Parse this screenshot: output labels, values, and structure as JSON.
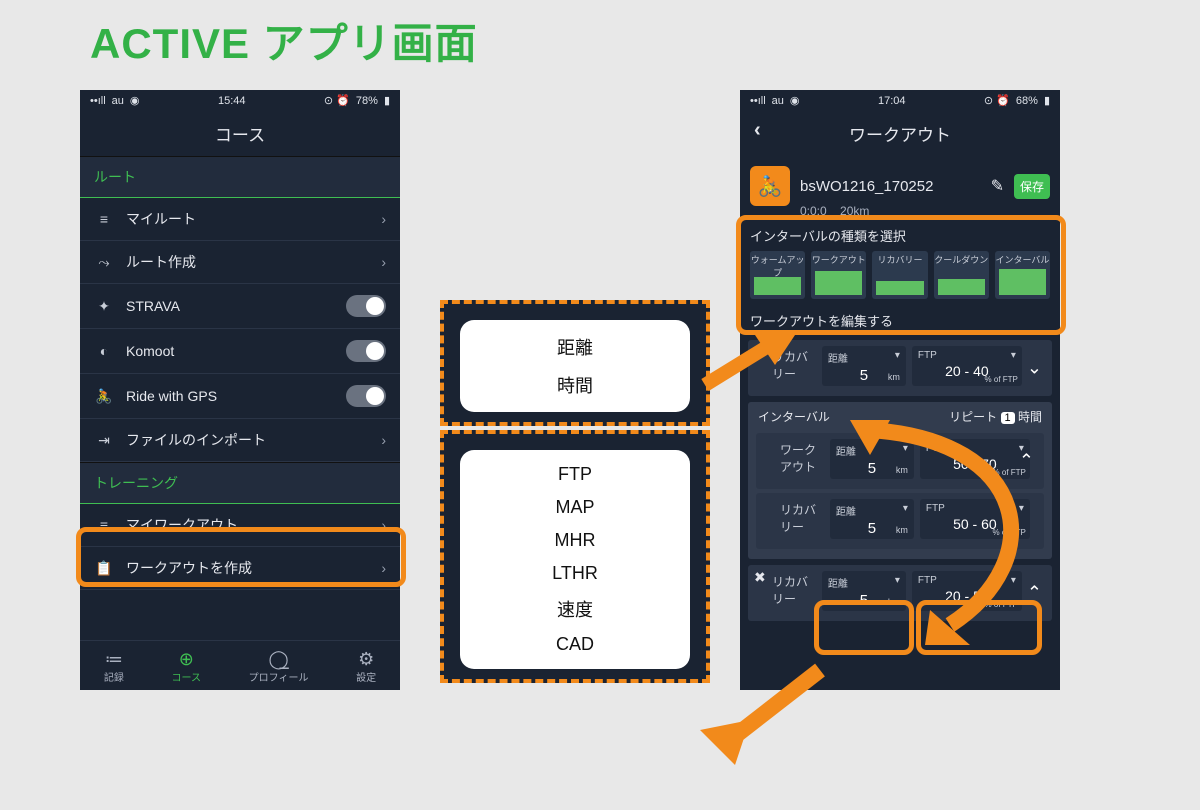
{
  "page": {
    "title": "ACTIVE アプリ画面"
  },
  "phone_left": {
    "status": {
      "carrier": "au",
      "time": "15:44",
      "battery": "78%"
    },
    "nav_title": "コース",
    "section_route": "ルート",
    "items_route": [
      {
        "label": "マイルート",
        "type": "chevron"
      },
      {
        "label": "ルート作成",
        "type": "chevron"
      },
      {
        "label": "STRAVA",
        "type": "toggle"
      },
      {
        "label": "Komoot",
        "type": "toggle"
      },
      {
        "label": "Ride with GPS",
        "type": "toggle"
      },
      {
        "label": "ファイルのインポート",
        "type": "chevron"
      }
    ],
    "section_training": "トレーニング",
    "items_training": [
      {
        "label": "マイワークアウト",
        "type": "chevron"
      },
      {
        "label": "ワークアウトを作成",
        "type": "chevron"
      }
    ],
    "tabs": [
      {
        "label": "記録"
      },
      {
        "label": "コース"
      },
      {
        "label": "プロフィール"
      },
      {
        "label": "設定"
      }
    ]
  },
  "picker_top": {
    "options": [
      "距離",
      "時間"
    ]
  },
  "picker_bottom": {
    "options": [
      "FTP",
      "MAP",
      "MHR",
      "LTHR",
      "速度",
      "CAD"
    ]
  },
  "phone_right": {
    "status": {
      "carrier": "au",
      "time": "17:04",
      "battery": "68%"
    },
    "nav_title": "ワークアウト",
    "workout": {
      "name": "bsWO1216_170252",
      "duration": "0:0:0",
      "distance": "20km",
      "save": "保存"
    },
    "interval_type_label": "インターバルの種類を選択",
    "chips": [
      "ウォームアップ",
      "ワークアウト",
      "リカバリー",
      "クールダウン",
      "インターバル"
    ],
    "edit_label": "ワークアウトを編集する",
    "interval_header": {
      "label": "インターバル",
      "repeat_label": "リピート",
      "repeat_value": "1",
      "repeat_unit": "時間"
    },
    "dist_label": "距離",
    "ftp_label": "FTP",
    "unit_km": "km",
    "pof": "% of FTP",
    "cards": [
      {
        "seg": "リカバリー",
        "dist": "5",
        "lo": "20",
        "hi": "40"
      },
      {
        "seg": "ワークアウト",
        "dist": "5",
        "lo": "50",
        "hi": "70"
      },
      {
        "seg": "リカバリー",
        "dist": "5",
        "lo": "50",
        "hi": "60"
      },
      {
        "seg": "リカバリー",
        "dist": "5",
        "lo": "20",
        "hi": "55"
      }
    ]
  }
}
